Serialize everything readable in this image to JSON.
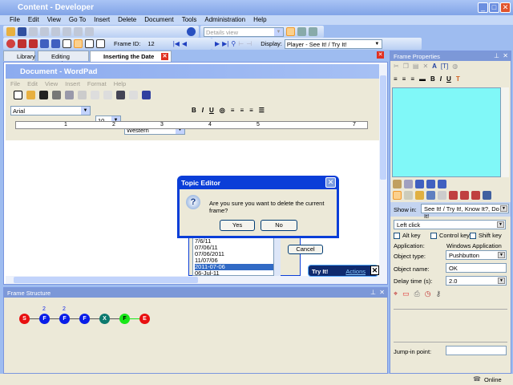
{
  "window": {
    "title": "Content - Developer"
  },
  "menu": [
    "File",
    "Edit",
    "View",
    "Go To",
    "Insert",
    "Delete",
    "Document",
    "Tools",
    "Administration",
    "Help"
  ],
  "toolbar": {
    "view_combo": "Details view",
    "frame_id_label": "Frame ID:",
    "frame_id": "12",
    "display_label": "Display:",
    "display_value": "Player - See It! / Try It!"
  },
  "tabs": [
    {
      "label": "Library"
    },
    {
      "label": "Editing Basics"
    },
    {
      "label": "Inserting the Date",
      "active": true
    }
  ],
  "wordpad": {
    "title": "Document - WordPad",
    "menu": [
      "File",
      "Edit",
      "View",
      "Insert",
      "Format",
      "Help"
    ],
    "font": "Arial",
    "size": "10",
    "script": "Western",
    "ruler": [
      "1",
      "2",
      "3",
      "4",
      "5",
      "7"
    ]
  },
  "datelist": [
    "7/6/11",
    "07/06/11",
    "07/06/2011",
    "11/07/06",
    "2011-07-06",
    "06-Jul-11"
  ],
  "cancel_label": "Cancel",
  "tryit": {
    "title": "Try It!",
    "actions": "Actions"
  },
  "dialog": {
    "title": "Topic Editor",
    "message": "Are you sure you want to delete the current frame?",
    "yes": "Yes",
    "no": "No"
  },
  "frame_structure": {
    "title": "Frame Structure",
    "nodes": [
      {
        "l": "S",
        "c": "#e81010"
      },
      {
        "l": "F",
        "c": "#0a1ee8",
        "n": "2"
      },
      {
        "l": "F",
        "c": "#0a1ee8",
        "n": "2"
      },
      {
        "l": "F",
        "c": "#0a1ee8"
      },
      {
        "l": "X",
        "c": "#0d7a6e"
      },
      {
        "l": "F",
        "c": "#18e818"
      },
      {
        "l": "E",
        "c": "#e81010"
      }
    ]
  },
  "props": {
    "title": "Frame Properties",
    "text_bg": "#80f8f8",
    "show_in_label": "Show in:",
    "show_in": "See It! / Try It!, Know It?, Do It!",
    "action": "Left click",
    "alt": "Alt key",
    "ctrl": "Control key",
    "shift": "Shift key",
    "app_label": "Application:",
    "app": "Windows Application",
    "objtype_label": "Object type:",
    "objtype": "Pushbutton",
    "objname_label": "Object name:",
    "objname": "OK",
    "delay_label": "Delay time (s):",
    "delay": "2.0",
    "jump_label": "Jump-in point:",
    "jump": ""
  },
  "status": {
    "online": "Online"
  }
}
